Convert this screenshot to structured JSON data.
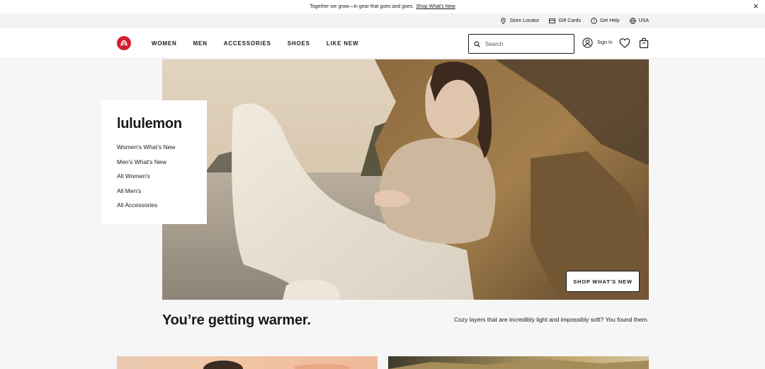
{
  "promo": {
    "text": "Together we grow—in gear that goes and goes.",
    "link": "Shop What's New"
  },
  "utility": {
    "store_locator": "Store Locator",
    "gift_cards": "Gift Cards",
    "get_help": "Get Help",
    "region": "USA"
  },
  "header": {
    "nav": [
      "WOMEN",
      "MEN",
      "ACCESSORIES",
      "SHOES",
      "LIKE NEW"
    ],
    "search_placeholder": "Search",
    "sign_in": "Sign In"
  },
  "panel": {
    "title": "lululemon",
    "links": [
      "Women's What's New",
      "Men's What's New",
      "All Women's",
      "All Men's",
      "All Accessories"
    ]
  },
  "hero": {
    "cta": "SHOP WHAT'S NEW"
  },
  "section": {
    "headline": "You’re getting warmer.",
    "subcopy": "Cozy layers that are incredibly light and impossibly soft? You found them."
  },
  "colors": {
    "brand_red": "#d22030",
    "text": "#1a1a1a",
    "page_bg": "#f6f6f6"
  }
}
